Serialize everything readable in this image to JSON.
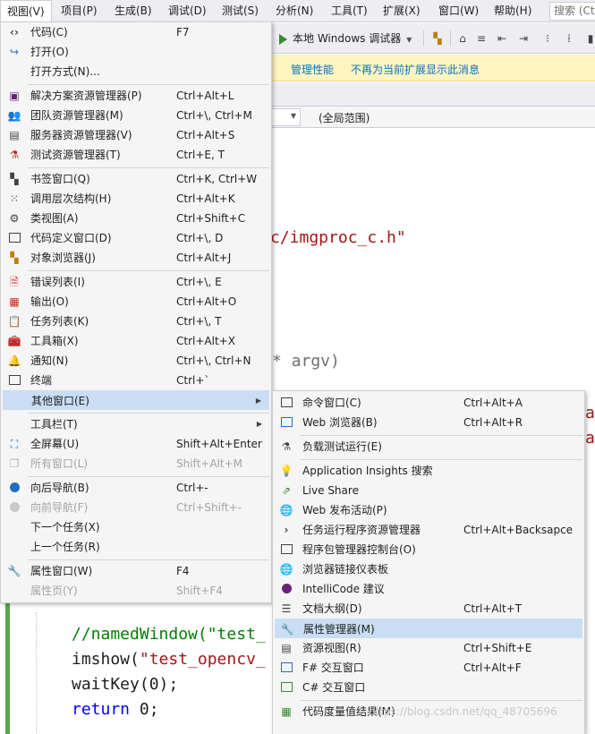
{
  "menubar": {
    "items": [
      {
        "label": "视图(V)",
        "active": true
      },
      {
        "label": "项目(P)"
      },
      {
        "label": "生成(B)"
      },
      {
        "label": "调试(D)"
      },
      {
        "label": "测试(S)"
      },
      {
        "label": "分析(N)"
      },
      {
        "label": "工具(T)"
      },
      {
        "label": "扩展(X)"
      },
      {
        "label": "窗口(W)"
      },
      {
        "label": "帮助(H)"
      }
    ],
    "search_text": "搜索 (Ct"
  },
  "toolbar": {
    "run_label": "本地 Windows 调试器"
  },
  "infobar": {
    "manage_link": "管理性能",
    "dismiss_link": "不再为当前扩展显示此消息"
  },
  "navbar": {
    "scope": "(全局范围)"
  },
  "editor": {
    "include_fragment": "c/imgproc_c.h\"",
    "argv_fragment": "* argv)",
    "line_named_window": "//namedWindow(\"test_",
    "line_imshow_fn": "imshow(",
    "line_imshow_str": "\"test_opencv_",
    "line_waitkey": "waitKey(0);",
    "line_return_kw": "return",
    "line_return_val": " 0;",
    "right_edge_a1": "a",
    "right_edge_a2": "a"
  },
  "view_menu": {
    "items": [
      {
        "label": "代码(C)",
        "shortcut": "F7",
        "icon": "code-icon"
      },
      {
        "label": "打开(O)",
        "shortcut": "",
        "icon": "open-icon"
      },
      {
        "label": "打开方式(N)...",
        "shortcut": "",
        "icon": ""
      },
      {
        "label": "解决方案资源管理器(P)",
        "shortcut": "Ctrl+Alt+L",
        "icon": "solution-explorer-icon"
      },
      {
        "label": "团队资源管理器(M)",
        "shortcut": "Ctrl+\\, Ctrl+M",
        "icon": "team-explorer-icon"
      },
      {
        "label": "服务器资源管理器(V)",
        "shortcut": "Ctrl+Alt+S",
        "icon": "server-explorer-icon"
      },
      {
        "label": "测试资源管理器(T)",
        "shortcut": "Ctrl+E, T",
        "icon": "test-explorer-icon"
      },
      {
        "label": "书签窗口(Q)",
        "shortcut": "Ctrl+K, Ctrl+W",
        "icon": "bookmark-icon"
      },
      {
        "label": "调用层次结构(H)",
        "shortcut": "Ctrl+Alt+K",
        "icon": "call-hierarchy-icon"
      },
      {
        "label": "类视图(A)",
        "shortcut": "Ctrl+Shift+C",
        "icon": "class-view-icon"
      },
      {
        "label": "代码定义窗口(D)",
        "shortcut": "Ctrl+\\, D",
        "icon": "code-definition-icon"
      },
      {
        "label": "对象浏览器(J)",
        "shortcut": "Ctrl+Alt+J",
        "icon": "object-browser-icon"
      },
      {
        "label": "错误列表(I)",
        "shortcut": "Ctrl+\\, E",
        "icon": "error-list-icon"
      },
      {
        "label": "输出(O)",
        "shortcut": "Ctrl+Alt+O",
        "icon": "output-icon"
      },
      {
        "label": "任务列表(K)",
        "shortcut": "Ctrl+\\, T",
        "icon": "task-list-icon"
      },
      {
        "label": "工具箱(X)",
        "shortcut": "Ctrl+Alt+X",
        "icon": "toolbox-icon"
      },
      {
        "label": "通知(N)",
        "shortcut": "Ctrl+\\, Ctrl+N",
        "icon": "bell-icon"
      },
      {
        "label": "终端",
        "shortcut": "Ctrl+`",
        "icon": "terminal-icon"
      },
      {
        "label": "其他窗口(E)",
        "shortcut": "",
        "icon": "",
        "highlighted": true,
        "submenu": true
      },
      {
        "label": "工具栏(T)",
        "shortcut": "",
        "icon": "",
        "submenu": true
      },
      {
        "label": "全屏幕(U)",
        "shortcut": "Shift+Alt+Enter",
        "icon": "fullscreen-icon"
      },
      {
        "label": "所有窗口(L)",
        "shortcut": "Shift+Alt+M",
        "icon": "all-windows-icon",
        "disabled": true
      },
      {
        "label": "向后导航(B)",
        "shortcut": "Ctrl+-",
        "icon": "back-icon"
      },
      {
        "label": "向前导航(F)",
        "shortcut": "Ctrl+Shift+-",
        "icon": "forward-icon",
        "disabled": true
      },
      {
        "label": "下一个任务(X)",
        "shortcut": "",
        "icon": ""
      },
      {
        "label": "上一个任务(R)",
        "shortcut": "",
        "icon": ""
      },
      {
        "label": "属性窗口(W)",
        "shortcut": "F4",
        "icon": "wrench-icon"
      },
      {
        "label": "属性页(Y)",
        "shortcut": "Shift+F4",
        "icon": "",
        "disabled": true
      }
    ]
  },
  "other_windows_menu": {
    "items": [
      {
        "label": "命令窗口(C)",
        "shortcut": "Ctrl+Alt+A",
        "icon": "command-window-icon"
      },
      {
        "label": "Web 浏览器(B)",
        "shortcut": "Ctrl+Alt+R",
        "icon": "web-browser-icon"
      },
      {
        "label": "负载测试运行(E)",
        "shortcut": "",
        "icon": "load-test-icon"
      },
      {
        "label": "Application Insights 搜索",
        "shortcut": "",
        "icon": "app-insights-icon"
      },
      {
        "label": "Live Share",
        "shortcut": "",
        "icon": "live-share-icon"
      },
      {
        "label": "Web 发布活动(P)",
        "shortcut": "",
        "icon": "globe-icon"
      },
      {
        "label": "任务运行程序资源管理器",
        "shortcut": "Ctrl+Alt+Backsapce",
        "icon": "chevron-right-icon"
      },
      {
        "label": "程序包管理器控制台(O)",
        "shortcut": "",
        "icon": "package-console-icon"
      },
      {
        "label": "浏览器链接仪表板",
        "shortcut": "",
        "icon": "browser-link-icon"
      },
      {
        "label": "IntelliCode 建议",
        "shortcut": "",
        "icon": "intellicode-icon"
      },
      {
        "label": "文档大纲(D)",
        "shortcut": "Ctrl+Alt+T",
        "icon": "document-outline-icon"
      },
      {
        "label": "属性管理器(M)",
        "shortcut": "",
        "icon": "wrench-icon",
        "highlighted": true
      },
      {
        "label": "资源视图(R)",
        "shortcut": "Ctrl+Shift+E",
        "icon": "resource-view-icon"
      },
      {
        "label": "F# 交互窗口",
        "shortcut": "Ctrl+Alt+F",
        "icon": "fsharp-interactive-icon"
      },
      {
        "label": "C# 交互窗口",
        "shortcut": "",
        "icon": "csharp-interactive-icon"
      },
      {
        "label": "代码度量值结果(M)",
        "shortcut": "",
        "icon": "code-metrics-icon"
      }
    ]
  },
  "watermark": "https://blog.csdn.net/qq_48705696",
  "colors": {
    "menu_bg": "#f5f5f5",
    "highlight": "#c9def5",
    "infobar_bg": "#fdf4bf",
    "link": "#0e70c0",
    "run_green": "#388a34"
  }
}
